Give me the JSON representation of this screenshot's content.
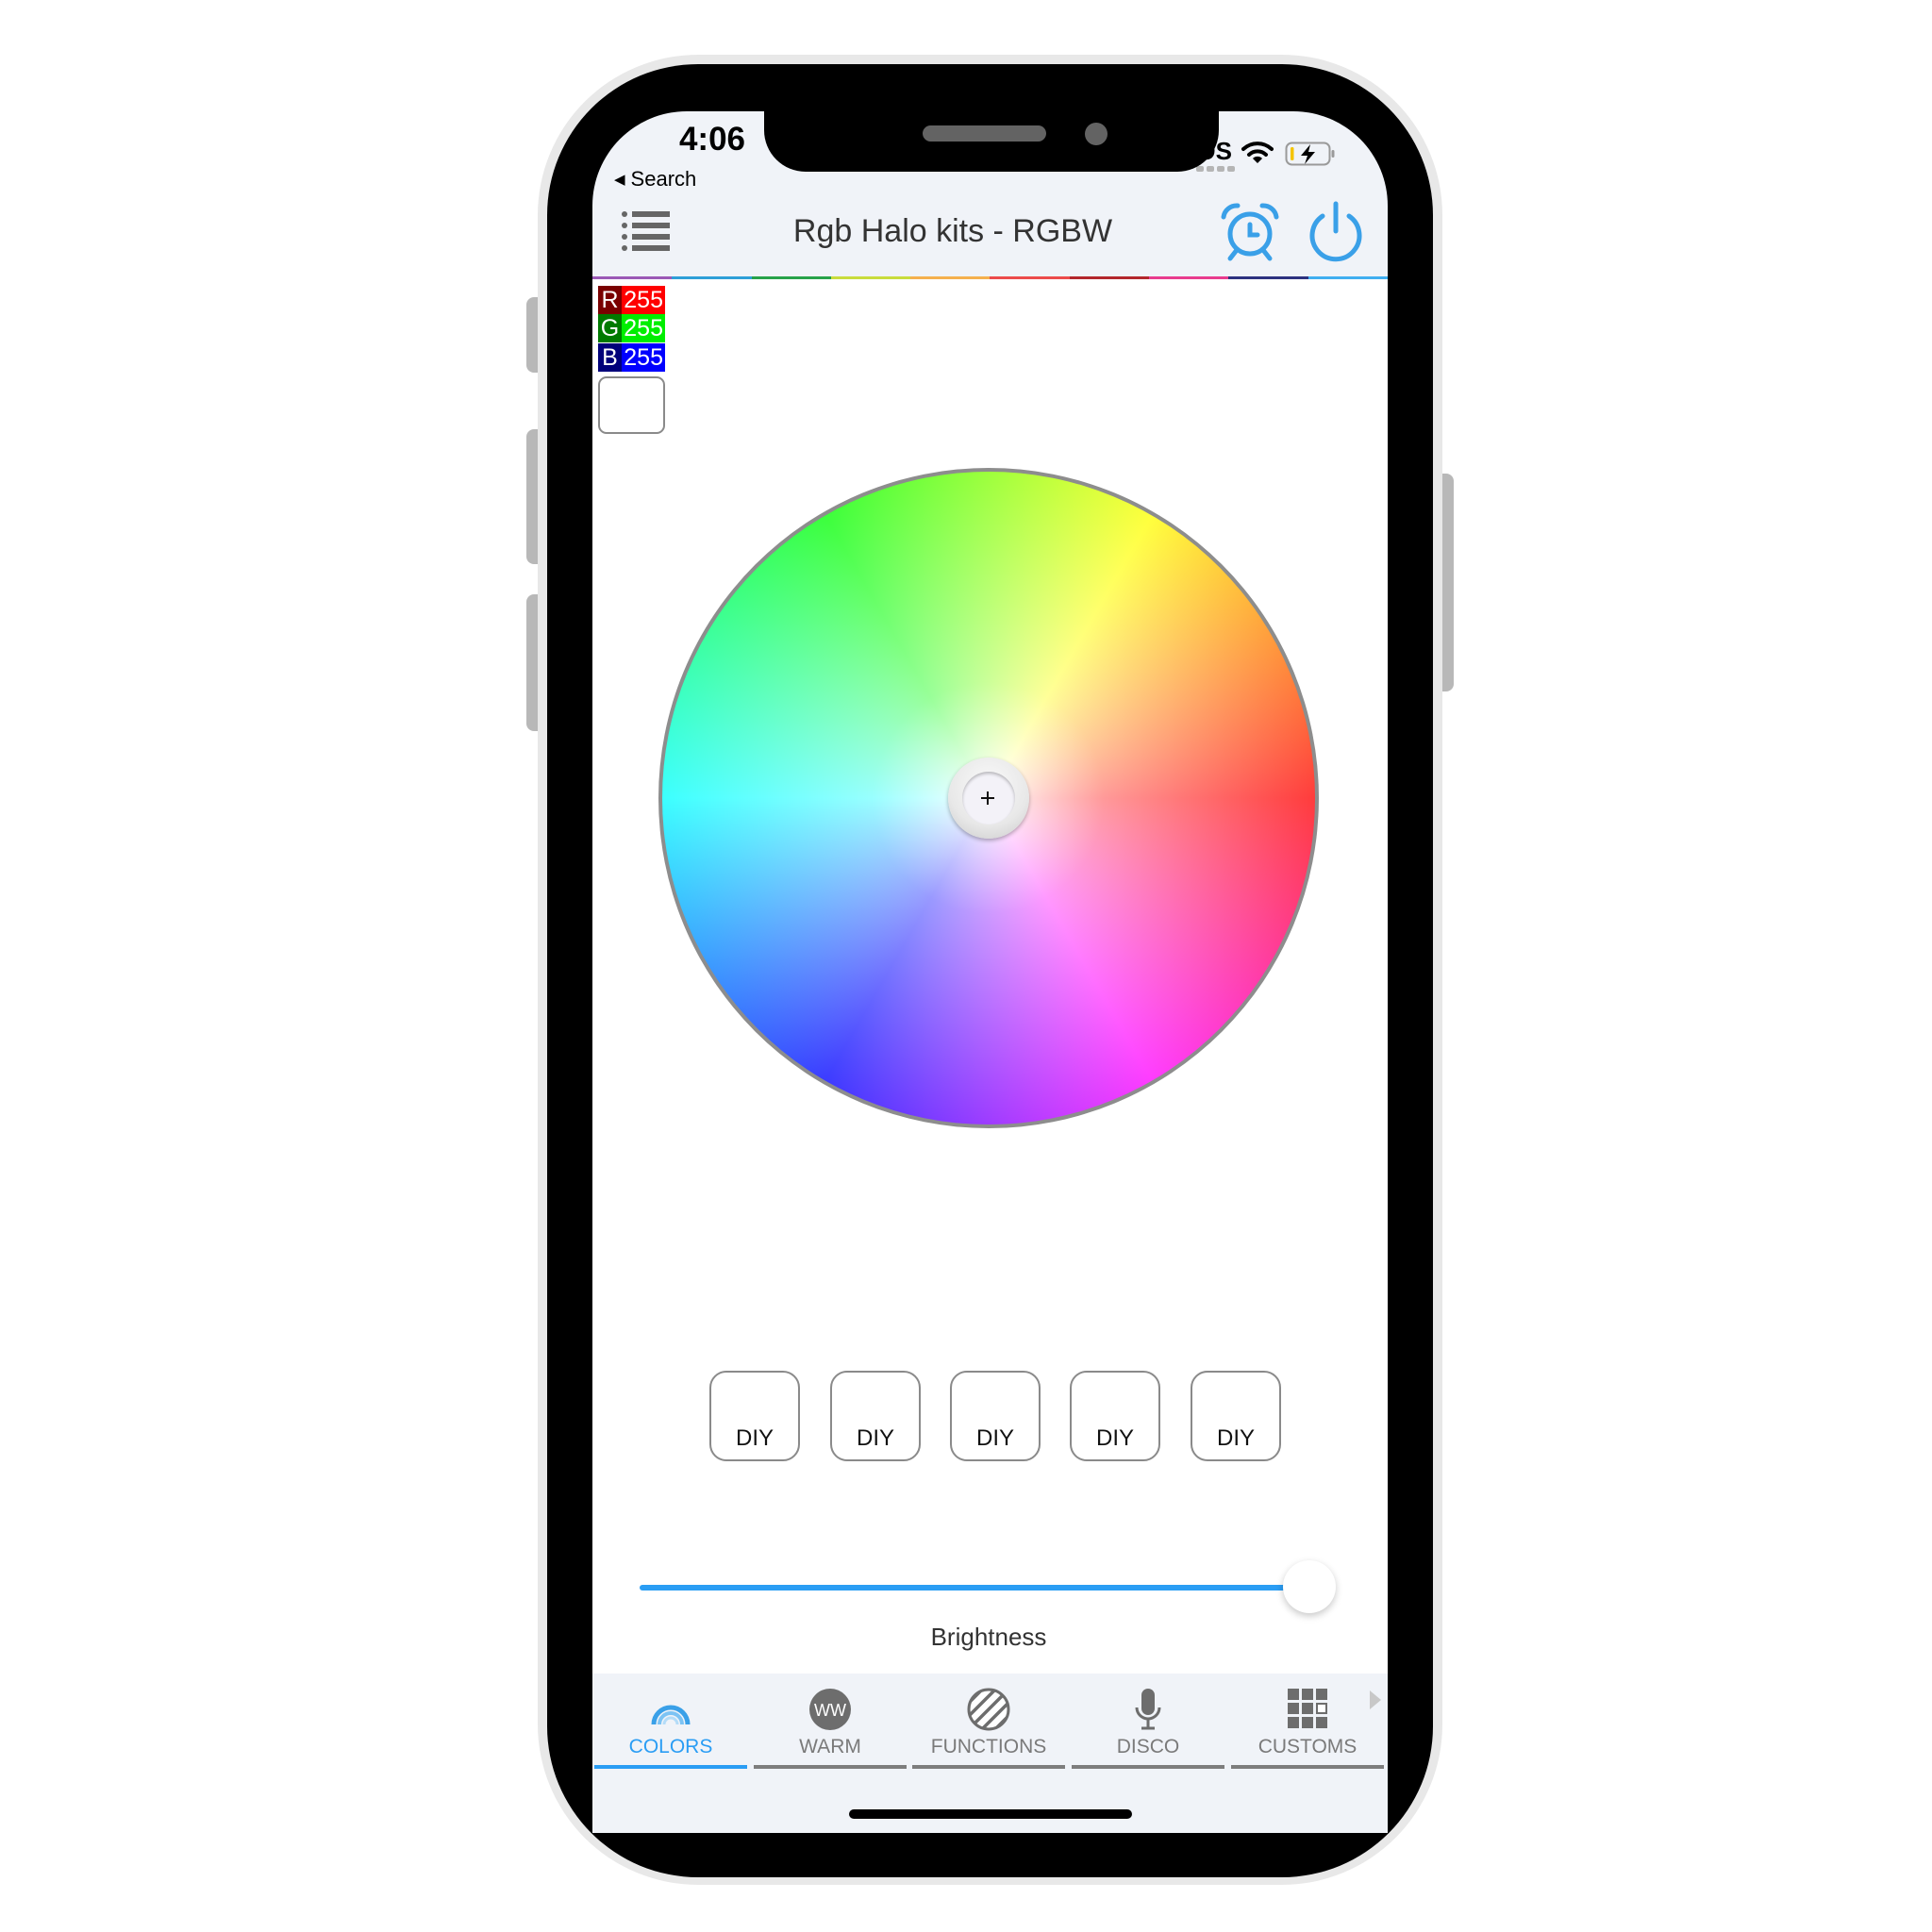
{
  "status_bar": {
    "time": "4:06",
    "back_label": "Search",
    "carrier": "SOS",
    "icons": [
      "cellular-dots-icon",
      "wifi-icon",
      "battery-charging-icon"
    ],
    "battery_level_color": "#f5c400"
  },
  "header": {
    "title": "Rgb Halo kits - RGBW",
    "menu_icon": "list-menu-icon",
    "alarm_icon": "alarm-clock-icon",
    "power_icon": "power-icon",
    "accent_color": "#2a9df4",
    "rainbow_colors": [
      "#9b59b6",
      "#2e9fd8",
      "#27a24a",
      "#c9dc3c",
      "#f5b04e",
      "#ec4b4b",
      "#b3262c",
      "#e83c8e",
      "#2d3280",
      "#40aef0"
    ]
  },
  "rgb_readout": {
    "r_label": "R",
    "r_value": "255",
    "g_label": "G",
    "g_value": "255",
    "b_label": "B",
    "b_value": "255",
    "swatch_color": "#ffffff"
  },
  "color_wheel": {
    "selected_hue_center": "white",
    "crosshair_icon": "crosshair-icon"
  },
  "diy_buttons": [
    "DIY",
    "DIY",
    "DIY",
    "DIY",
    "DIY"
  ],
  "brightness": {
    "label": "Brightness",
    "value_percent": 100
  },
  "tabs": [
    {
      "label": "COLORS",
      "icon": "rainbow-icon",
      "active": true
    },
    {
      "label": "WARM",
      "icon": "ww-badge-icon",
      "icon_text": "WW",
      "active": false
    },
    {
      "label": "FUNCTIONS",
      "icon": "striped-circle-icon",
      "active": false
    },
    {
      "label": "DISCO",
      "icon": "microphone-icon",
      "active": false
    },
    {
      "label": "CUSTOMS",
      "icon": "grid-icon",
      "active": false
    }
  ],
  "tab_scroll_icon": "chevron-right-icon"
}
